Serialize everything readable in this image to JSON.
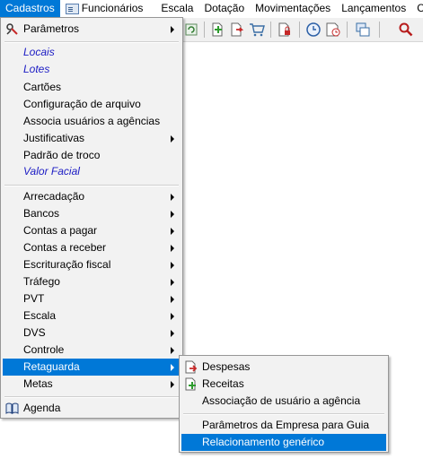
{
  "menubar": {
    "items": [
      {
        "label": "Cadastros",
        "active": true
      },
      {
        "label": "Funcionários",
        "icon": "id-card-icon"
      },
      {
        "label": "Escala"
      },
      {
        "label": "Dotação"
      },
      {
        "label": "Movimentações"
      },
      {
        "label": "Lançamentos"
      },
      {
        "label": "C"
      }
    ]
  },
  "toolbar": {
    "buttons": [
      "refresh-icon",
      "add-document-icon",
      "export-document-icon",
      "shopping-cart-icon",
      "lock-document-icon",
      "clock-icon",
      "schedule-icon",
      "copy-window-icon",
      "search-icon"
    ]
  },
  "cadastros_menu": {
    "items": [
      {
        "label": "Parâmetros",
        "submenu": true,
        "icon": "parameters-icon"
      },
      {
        "label": "Locais",
        "italic": true
      },
      {
        "label": "Lotes",
        "italic": true
      },
      {
        "label": "Cartões"
      },
      {
        "label": "Configuração de arquivo"
      },
      {
        "label": "Associa usuários a agências"
      },
      {
        "label": "Justificativas",
        "submenu": true
      },
      {
        "label": "Padrão de troco"
      },
      {
        "label": "Valor Facial",
        "italic": true
      },
      {
        "label": "Arrecadação",
        "submenu": true
      },
      {
        "label": "Bancos",
        "submenu": true
      },
      {
        "label": "Contas a pagar",
        "submenu": true
      },
      {
        "label": "Contas a receber",
        "submenu": true
      },
      {
        "label": "Escrituração fiscal",
        "submenu": true
      },
      {
        "label": "Tráfego",
        "submenu": true
      },
      {
        "label": "PVT",
        "submenu": true
      },
      {
        "label": "Escala",
        "submenu": true
      },
      {
        "label": "DVS",
        "submenu": true
      },
      {
        "label": "Controle",
        "submenu": true
      },
      {
        "label": "Retaguarda",
        "submenu": true,
        "highlighted": true
      },
      {
        "label": "Metas",
        "submenu": true
      },
      {
        "label": "Agenda",
        "icon": "book-icon"
      }
    ]
  },
  "retaguarda_submenu": {
    "items": [
      {
        "label": "Despesas",
        "icon": "expense-icon"
      },
      {
        "label": "Receitas",
        "icon": "income-icon"
      },
      {
        "label": "Associação de usuário a agência"
      },
      {
        "label": "Parâmetros da Empresa para Guia"
      },
      {
        "label": "Relacionamento genérico",
        "highlighted": true
      }
    ]
  },
  "colors": {
    "highlight": "#0078d7",
    "italic_link": "#1c1cc4",
    "menu_bg": "#f2f2f2"
  }
}
